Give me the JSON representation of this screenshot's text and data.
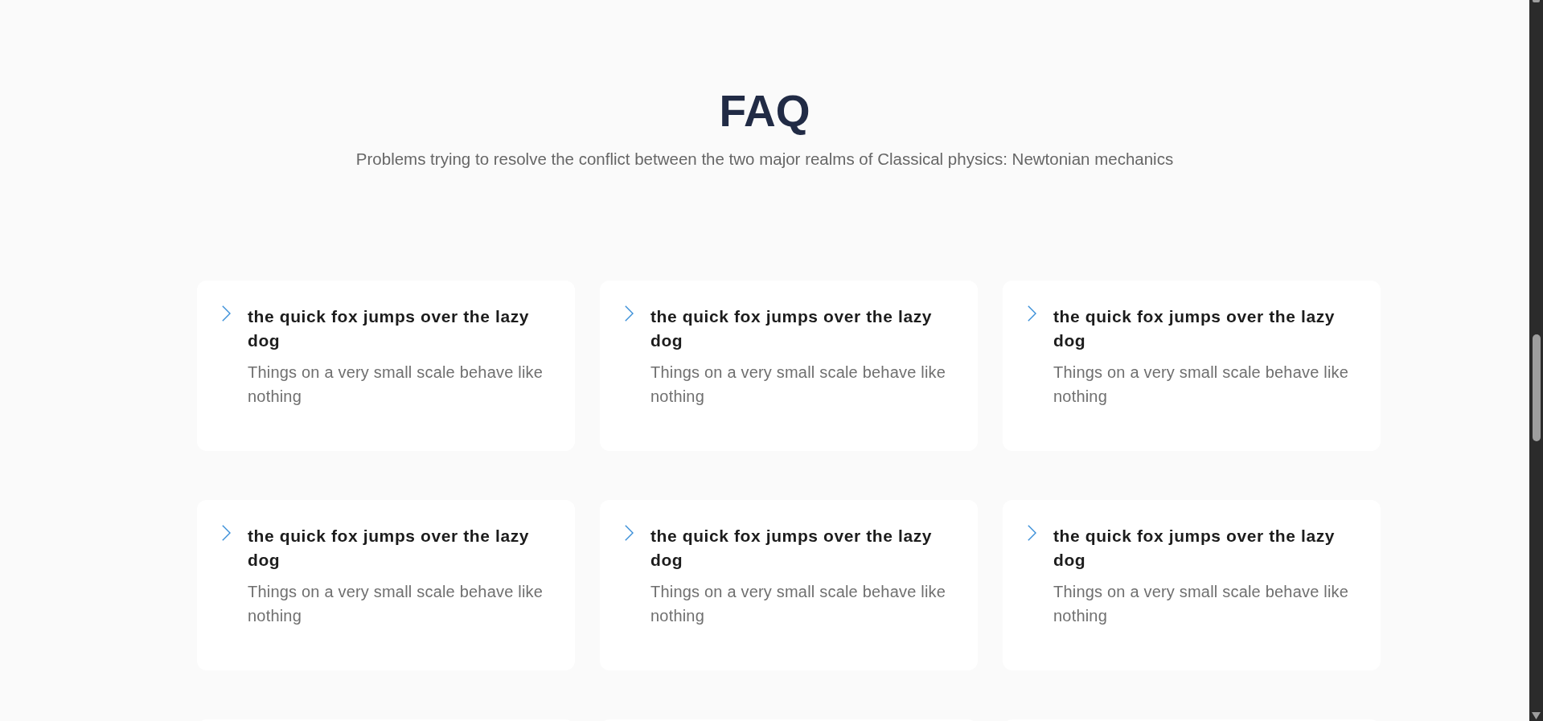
{
  "header": {
    "title": "FAQ",
    "subtitle": "Problems trying to resolve the conflict between the two major realms of Classical physics: Newtonian mechanics"
  },
  "faq_items": [
    {
      "question": "the quick fox jumps over the lazy dog",
      "answer": "Things on a very small scale behave like nothing"
    },
    {
      "question": "the quick fox jumps over the lazy dog",
      "answer": "Things on a very small scale behave like nothing"
    },
    {
      "question": "the quick fox jumps over the lazy dog",
      "answer": "Things on a very small scale behave like nothing"
    },
    {
      "question": "the quick fox jumps over the lazy dog",
      "answer": "Things on a very small scale behave like nothing"
    },
    {
      "question": "the quick fox jumps over the lazy dog",
      "answer": "Things on a very small scale behave like nothing"
    },
    {
      "question": "the quick fox jumps over the lazy dog",
      "answer": "Things on a very small scale behave like nothing"
    }
  ]
}
